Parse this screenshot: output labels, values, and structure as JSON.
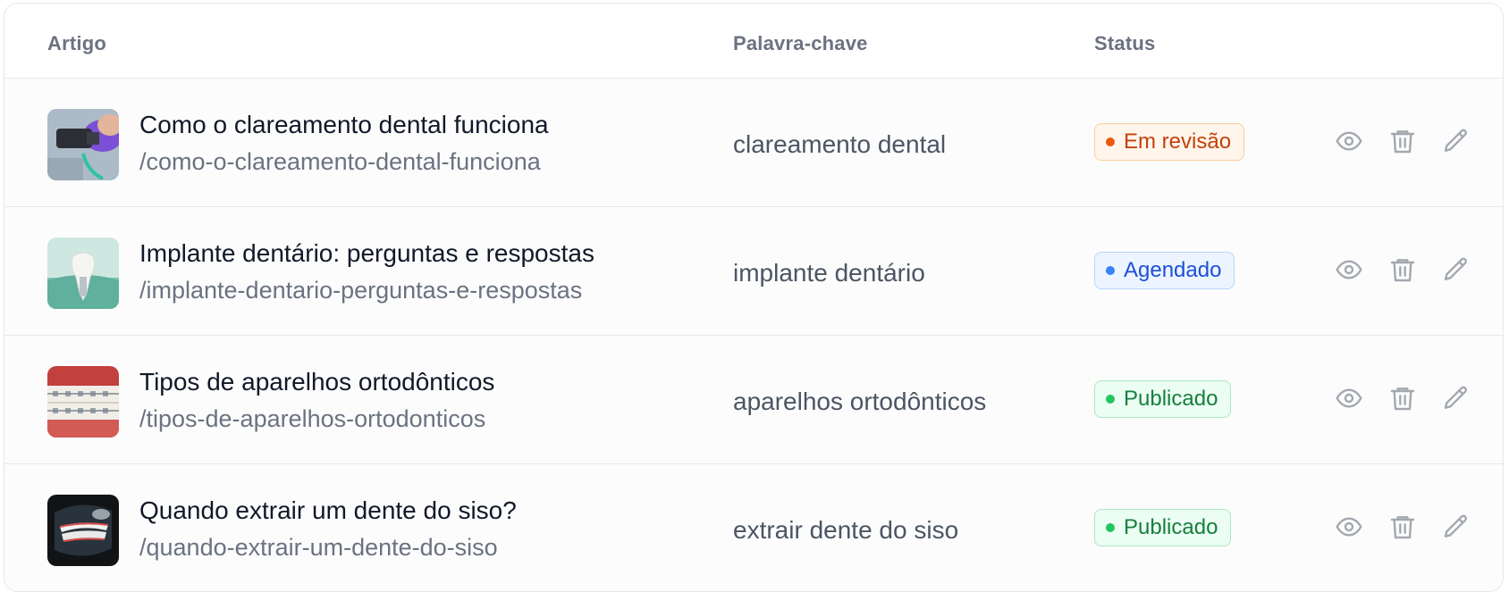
{
  "table": {
    "columns": {
      "article": "Artigo",
      "keyword": "Palavra-chave",
      "status": "Status"
    },
    "rows": [
      {
        "title": "Como o clareamento dental funciona",
        "slug": "/como-o-clareamento-dental-funciona",
        "keyword": "clareamento dental",
        "status": "Em revisão",
        "status_kind": "review",
        "thumbnail": "teeth-whitening-photo"
      },
      {
        "title": "Implante dentário: perguntas e respostas",
        "slug": "/implante-dentario-perguntas-e-respostas",
        "keyword": "implante dentário",
        "status": "Agendado",
        "status_kind": "scheduled",
        "thumbnail": "dental-implant-photo"
      },
      {
        "title": "Tipos de aparelhos ortodônticos",
        "slug": "/tipos-de-aparelhos-ortodonticos",
        "keyword": "aparelhos ortodônticos",
        "status": "Publicado",
        "status_kind": "published",
        "thumbnail": "braces-photo"
      },
      {
        "title": "Quando extrair um dente do siso?",
        "slug": "/quando-extrair-um-dente-do-siso",
        "keyword": "extrair dente do siso",
        "status": "Publicado",
        "status_kind": "published",
        "thumbnail": "wisdom-tooth-xray-photo"
      }
    ],
    "row_actions": [
      "eye-icon",
      "trash-icon",
      "pencil-icon"
    ]
  },
  "colors": {
    "review": "#c2410c",
    "scheduled": "#1d4ed8",
    "published": "#15803d",
    "icon": "#a3a8b0"
  }
}
